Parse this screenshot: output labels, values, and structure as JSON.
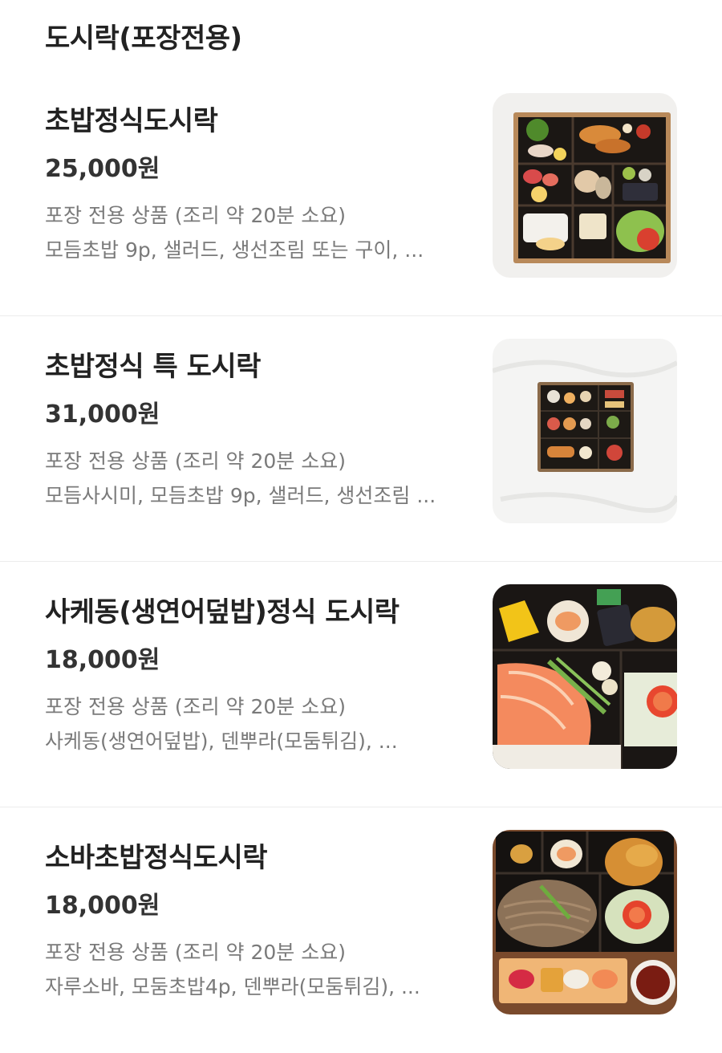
{
  "section": {
    "title": "도시락(포장전용)"
  },
  "menu": {
    "items": [
      {
        "name": "초밥정식도시락",
        "price": "25,000원",
        "note": "포장 전용 상품 (조리 약 20분 소요)",
        "description": "모듬초밥 9p, 샐러드, 생선조림 또는 구이, ...",
        "image": "sushi-set-lunchbox-photo"
      },
      {
        "name": "초밥정식 특 도시락",
        "price": "31,000원",
        "note": "포장 전용 상품 (조리 약 20분 소요)",
        "description": "모듬사시미, 모듬초밥 9p, 샐러드, 생선조림 ...",
        "image": "special-sushi-set-lunchbox-photo"
      },
      {
        "name": "사케동(생연어덮밥)정식 도시락",
        "price": "18,000원",
        "note": "포장 전용 상품 (조리 약 20분 소요)",
        "description": "사케동(생연어덮밥), 덴뿌라(모둠튀김), ...",
        "image": "salmon-rice-bowl-lunchbox-photo"
      },
      {
        "name": "소바초밥정식도시락",
        "price": "18,000원",
        "note": "포장 전용 상품 (조리 약 20분 소요)",
        "description": "자루소바, 모둠초밥4p, 덴뿌라(모둠튀김), ...",
        "image": "soba-sushi-lunchbox-photo"
      }
    ]
  }
}
